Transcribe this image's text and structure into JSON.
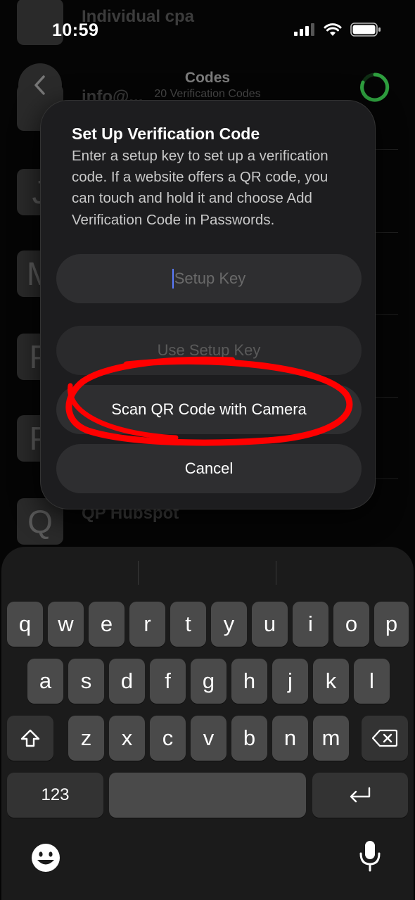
{
  "status": {
    "time": "10:59"
  },
  "nav": {
    "title": "Codes",
    "subtitle": "20 Verification Codes"
  },
  "background_list": [
    {
      "initial": "",
      "title": "Individual cpa",
      "subtitle": ""
    },
    {
      "initial": "",
      "title": "info@...",
      "subtitle": ""
    },
    {
      "initial": "J",
      "title": "",
      "subtitle": ""
    },
    {
      "initial": "M",
      "title": "",
      "subtitle": ""
    },
    {
      "initial": "P",
      "title": "",
      "subtitle": ""
    },
    {
      "initial": "P",
      "title": "",
      "subtitle": ""
    },
    {
      "initial": "Q",
      "title": "QP Hubspot",
      "subtitle": ""
    }
  ],
  "dialog": {
    "title": "Set Up Verification Code",
    "body": "Enter a setup key to set up a verification code. If a website offers a QR code, you can touch and hold it and choose Add Verification Code in Passwords.",
    "setup_placeholder": "Setup Key",
    "use_setup_key": "Use Setup Key",
    "scan_qr": "Scan QR Code with Camera",
    "cancel": "Cancel"
  },
  "keyboard": {
    "row1": [
      "q",
      "w",
      "e",
      "r",
      "t",
      "y",
      "u",
      "i",
      "o",
      "p"
    ],
    "row2": [
      "a",
      "s",
      "d",
      "f",
      "g",
      "h",
      "j",
      "k",
      "l"
    ],
    "row3": [
      "z",
      "x",
      "c",
      "v",
      "b",
      "n",
      "m"
    ],
    "numbers_key": "123",
    "icons": [
      "shift-icon",
      "delete-icon",
      "return-icon",
      "emoji-icon",
      "microphone-icon"
    ]
  },
  "colors": {
    "annotation": "#ff0000",
    "progress_ring": "#2e9e3e",
    "caret": "#5b7cff"
  }
}
